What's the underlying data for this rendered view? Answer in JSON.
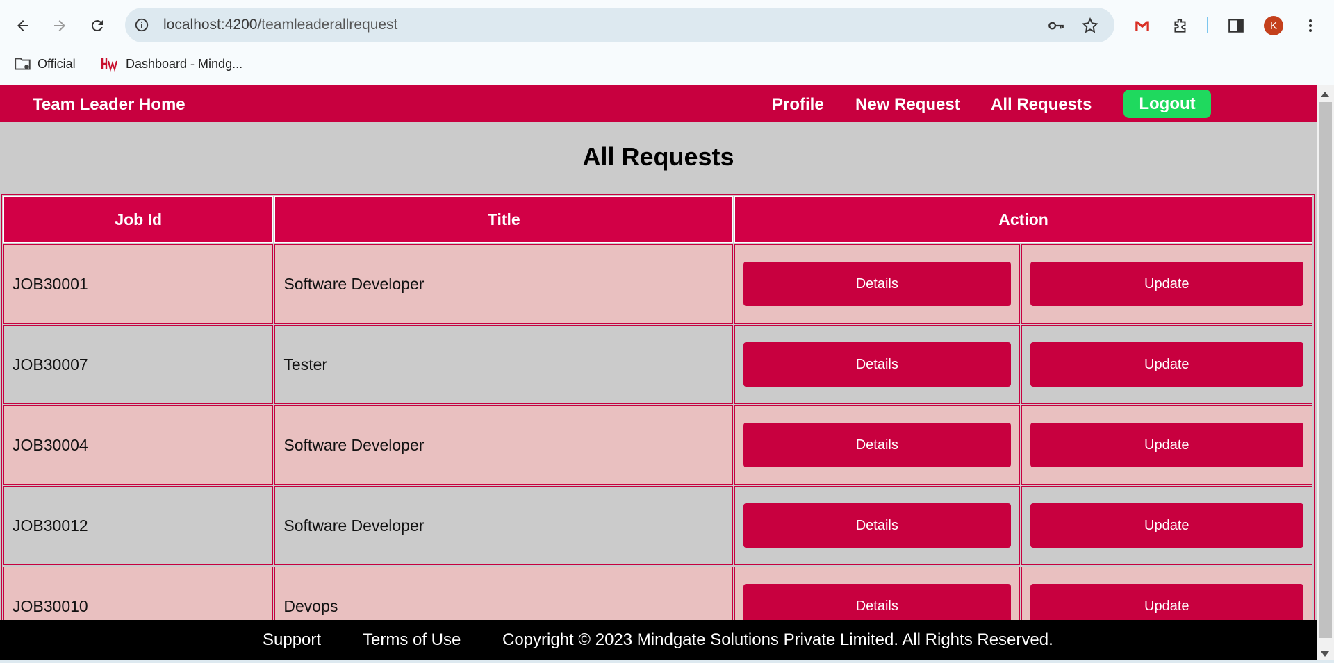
{
  "browser": {
    "url_host": "localhost:4200",
    "url_path": "/teamleaderallrequest",
    "avatar_letter": "K",
    "bookmarks": [
      {
        "label": "Official",
        "icon": "folder-gear-icon"
      },
      {
        "label": "Dashboard - Mindg...",
        "icon": "hw-logo-icon"
      }
    ]
  },
  "navbar": {
    "brand": "Team Leader Home",
    "links": [
      "Profile",
      "New Request",
      "All Requests"
    ],
    "logout": "Logout"
  },
  "page": {
    "title": "All Requests"
  },
  "table": {
    "headers": [
      "Job Id",
      "Title",
      "Action"
    ],
    "rows": [
      {
        "job_id": "JOB30001",
        "title": "Software Developer",
        "details": "Details",
        "update": "Update"
      },
      {
        "job_id": "JOB30007",
        "title": "Tester",
        "details": "Details",
        "update": "Update"
      },
      {
        "job_id": "JOB30004",
        "title": "Software Developer",
        "details": "Details",
        "update": "Update"
      },
      {
        "job_id": "JOB30012",
        "title": "Software Developer",
        "details": "Details",
        "update": "Update"
      },
      {
        "job_id": "JOB30010",
        "title": "Devops",
        "details": "Details",
        "update": "Update"
      }
    ]
  },
  "footer": {
    "support": "Support",
    "terms": "Terms of Use",
    "copyright": "Copyright © 2023 Mindgate Solutions Private Limited. All Rights Reserved."
  },
  "colors": {
    "navbar": "#c8003f",
    "header_cell": "#d20046",
    "row_pink": "#e9c0c0",
    "row_grey": "#cbcbcb",
    "logout": "#1fd95e",
    "footer": "#000000"
  }
}
